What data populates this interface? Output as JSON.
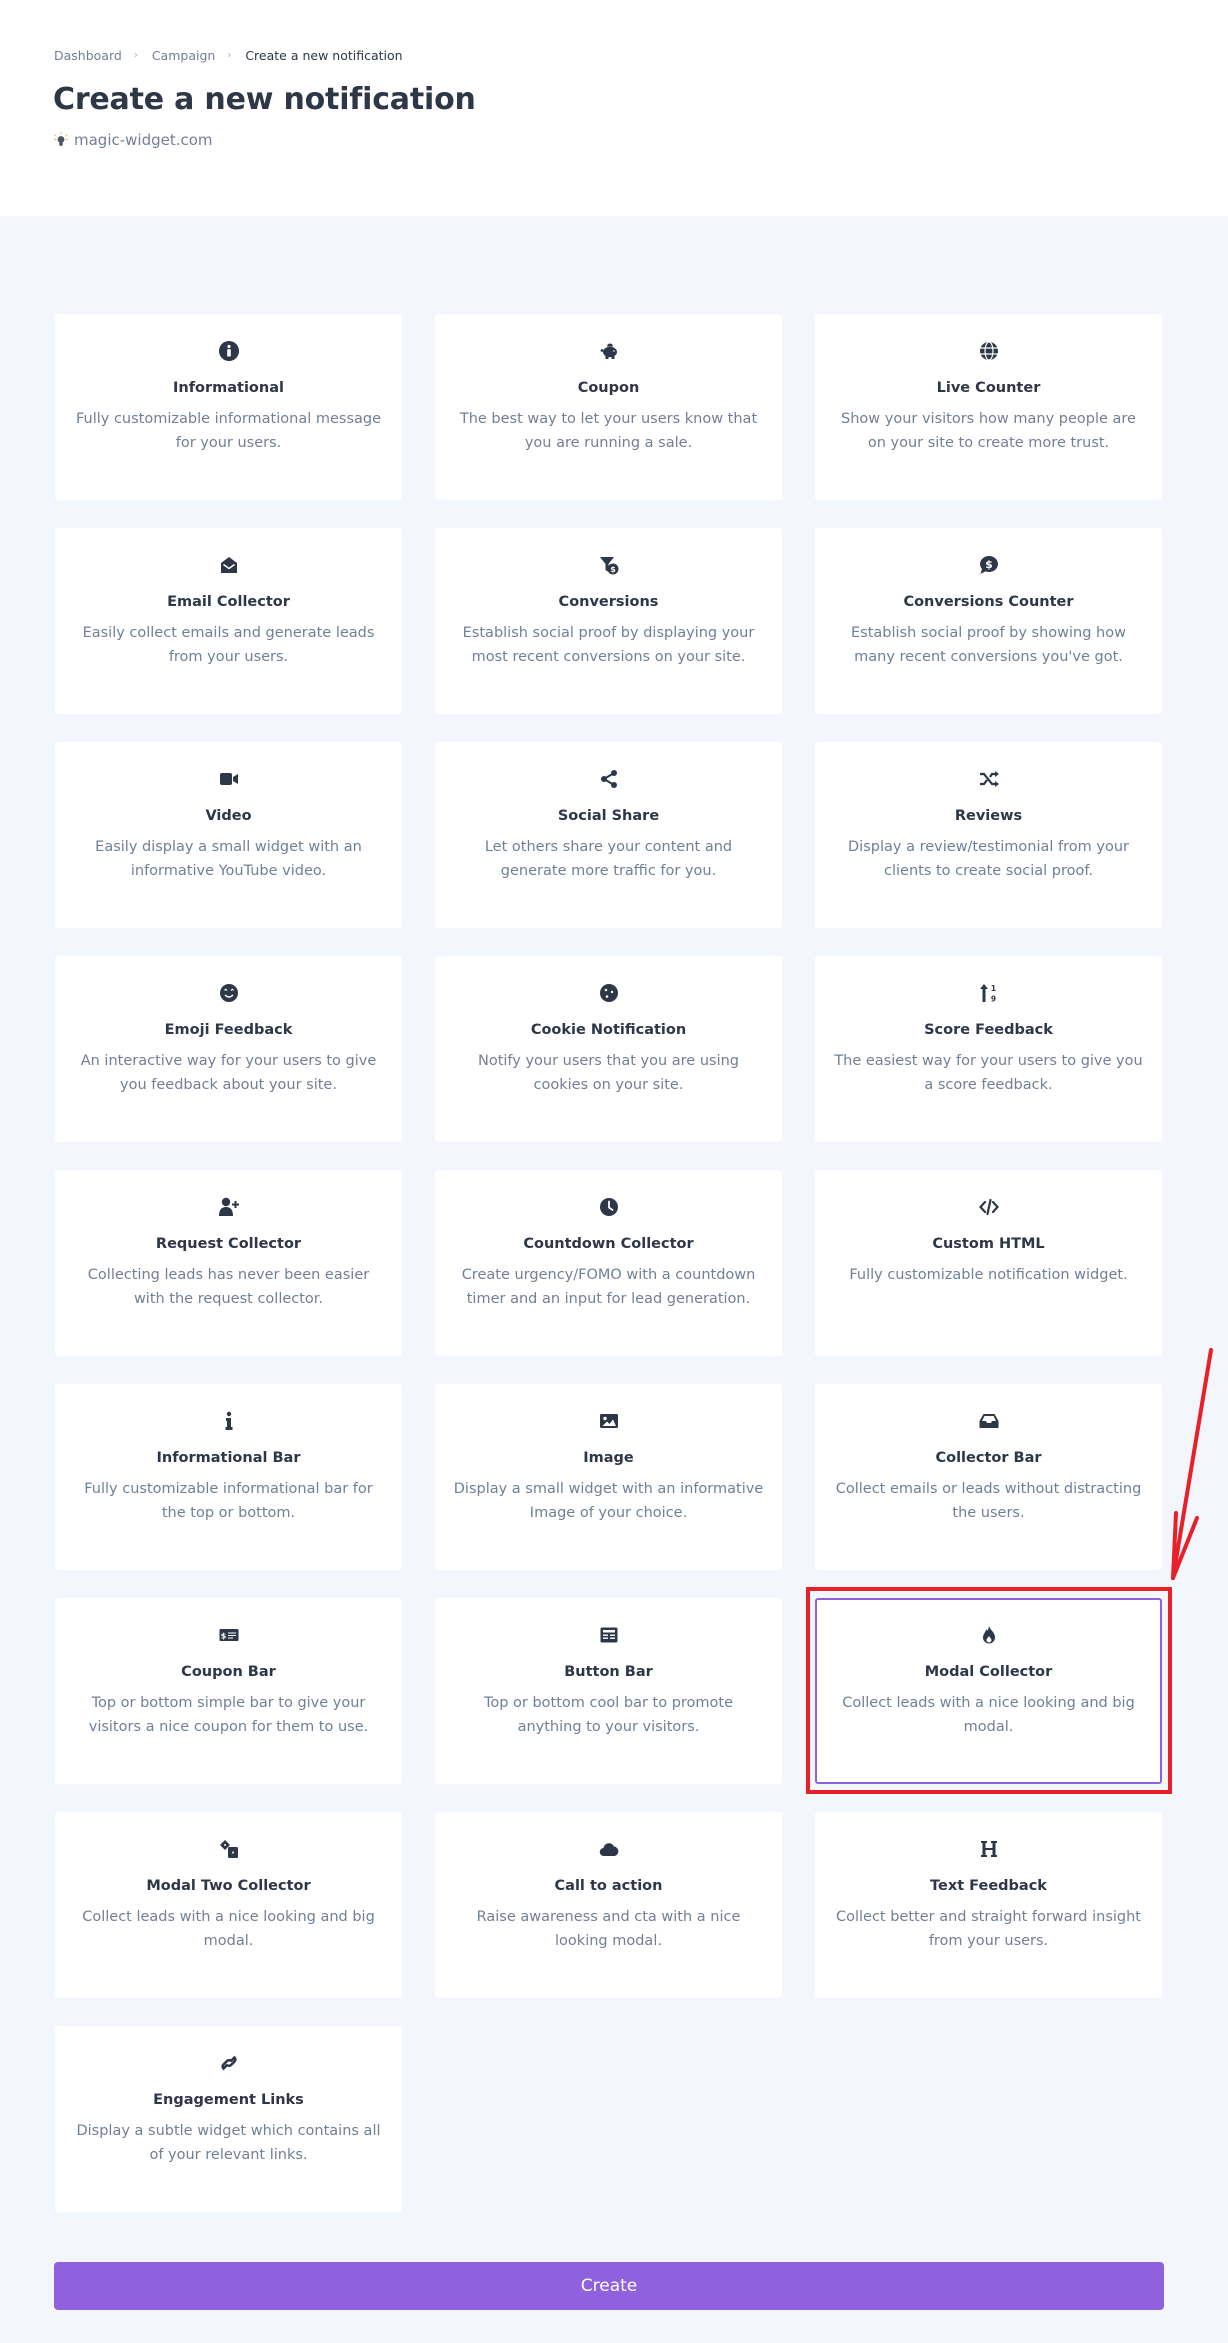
{
  "breadcrumb": [
    {
      "label": "Dashboard"
    },
    {
      "label": "Campaign"
    },
    {
      "label": "Create a new notification"
    }
  ],
  "page_title": "Create a new notification",
  "site": {
    "icon": "lightbulb-icon",
    "label": "magic-widget.com"
  },
  "notification_types": [
    {
      "id": "informational",
      "icon": "info-circle-icon",
      "title": "Informational",
      "description": "Fully customizable informational message for your users.",
      "selected": false
    },
    {
      "id": "coupon",
      "icon": "piggy-bank-icon",
      "title": "Coupon",
      "description": "The best way to let your users know that you are running a sale.",
      "selected": false
    },
    {
      "id": "live-counter",
      "icon": "globe-icon",
      "title": "Live Counter",
      "description": "Show your visitors how many people are on your site to create more trust.",
      "selected": false
    },
    {
      "id": "email-collector",
      "icon": "envelope-open-icon",
      "title": "Email Collector",
      "description": "Easily collect emails and generate leads from your users.",
      "selected": false
    },
    {
      "id": "conversions",
      "icon": "funnel-dollar-icon",
      "title": "Conversions",
      "description": "Establish social proof by displaying your most recent conversions on your site.",
      "selected": false
    },
    {
      "id": "conversions-counter",
      "icon": "comment-dollar-icon",
      "title": "Conversions Counter",
      "description": "Establish social proof by showing how many recent conversions you've got.",
      "selected": false
    },
    {
      "id": "video",
      "icon": "video-icon",
      "title": "Video",
      "description": "Easily display a small widget with an informative YouTube video.",
      "selected": false
    },
    {
      "id": "social-share",
      "icon": "share-icon",
      "title": "Social Share",
      "description": "Let others share your content and generate more traffic for you.",
      "selected": false
    },
    {
      "id": "reviews",
      "icon": "random-icon",
      "title": "Reviews",
      "description": "Display a review/testimonial from your clients to create social proof.",
      "selected": false
    },
    {
      "id": "emoji-feedback",
      "icon": "smile-icon",
      "title": "Emoji Feedback",
      "description": "An interactive way for your users to give you feedback about your site.",
      "selected": false
    },
    {
      "id": "cookie-notification",
      "icon": "cookie-icon",
      "title": "Cookie Notification",
      "description": "Notify your users that you are using cookies on your site.",
      "selected": false
    },
    {
      "id": "score-feedback",
      "icon": "sort-numeric-icon",
      "title": "Score Feedback",
      "description": "The easiest way for your users to give you a score feedback.",
      "selected": false
    },
    {
      "id": "request-collector",
      "icon": "user-plus-icon",
      "title": "Request Collector",
      "description": "Collecting leads has never been easier with the request collector.",
      "selected": false
    },
    {
      "id": "countdown-collector",
      "icon": "clock-icon",
      "title": "Countdown Collector",
      "description": "Create urgency/FOMO with a countdown timer and an input for lead generation.",
      "selected": false
    },
    {
      "id": "custom-html",
      "icon": "code-icon",
      "title": "Custom HTML",
      "description": "Fully customizable notification widget.",
      "selected": false
    },
    {
      "id": "informational-bar",
      "icon": "info-icon",
      "title": "Informational Bar",
      "description": "Fully customizable informational bar for the top or bottom.",
      "selected": false
    },
    {
      "id": "image",
      "icon": "image-icon",
      "title": "Image",
      "description": "Display a small widget with an informative Image of your choice.",
      "selected": false
    },
    {
      "id": "collector-bar",
      "icon": "inbox-icon",
      "title": "Collector Bar",
      "description": "Collect emails or leads without distracting the users.",
      "selected": false
    },
    {
      "id": "coupon-bar",
      "icon": "money-check-icon",
      "title": "Coupon Bar",
      "description": "Top or bottom simple bar to give your visitors a nice coupon for them to use.",
      "selected": false
    },
    {
      "id": "button-bar",
      "icon": "newspaper-icon",
      "title": "Button Bar",
      "description": "Top or bottom cool bar to promote anything to your visitors.",
      "selected": false
    },
    {
      "id": "modal-collector",
      "icon": "fire-icon",
      "title": "Modal Collector",
      "description": "Collect leads with a nice looking and big modal.",
      "selected": true
    },
    {
      "id": "modal-two-collector",
      "icon": "dice-icon",
      "title": "Modal Two Collector",
      "description": "Collect leads with a nice looking and big modal.",
      "selected": false
    },
    {
      "id": "call-to-action",
      "icon": "cloud-icon",
      "title": "Call to action",
      "description": "Raise awareness and cta with a nice looking modal.",
      "selected": false
    },
    {
      "id": "text-feedback",
      "icon": "heading-icon",
      "title": "Text Feedback",
      "description": "Collect better and straight forward insight from your users.",
      "selected": false
    },
    {
      "id": "engagement-links",
      "icon": "link-icon",
      "title": "Engagement Links",
      "description": "Display a subtle widget which contains all of your relevant links.",
      "selected": false
    }
  ],
  "create_button": {
    "label": "Create"
  },
  "colors": {
    "accent": "#9061df",
    "annotation": "#e8202a",
    "text_dark": "#2d3748",
    "text_muted": "#718096",
    "page_bg": "#f3f6fc"
  },
  "annotation": {
    "type": "highlight-with-arrow",
    "target": "modal-collector"
  }
}
